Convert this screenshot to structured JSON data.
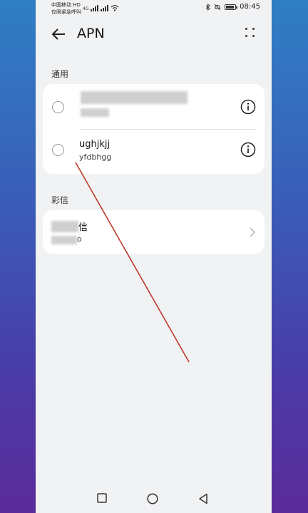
{
  "status_bar": {
    "carrier_line1": "中国移动 HD",
    "carrier_line2": "仅限紧急呼叫",
    "network": "4G",
    "time": "08:45"
  },
  "header": {
    "title": "APN",
    "back_icon": "arrow-left-icon",
    "more_icon": "four-dots-icon"
  },
  "sections": {
    "general": {
      "label": "通用",
      "items": [
        {
          "name": "",
          "sub": "",
          "redacted": true,
          "icon": "info-icon"
        },
        {
          "name": "ughjkjj",
          "sub": "yfdbhgg",
          "redacted": false,
          "icon": "info-icon"
        }
      ]
    },
    "mms": {
      "label": "彩信",
      "items": [
        {
          "name": "信",
          "sub": "o",
          "redacted": true,
          "icon": "chevron-right-icon"
        }
      ]
    }
  },
  "nav": {
    "recent_icon": "square-icon",
    "home_icon": "circle-icon",
    "back_icon": "triangle-back-icon"
  },
  "colors": {
    "page_bg": "#f1f2f4",
    "card_bg": "#ffffff",
    "annotation_line": "#c0392b"
  }
}
